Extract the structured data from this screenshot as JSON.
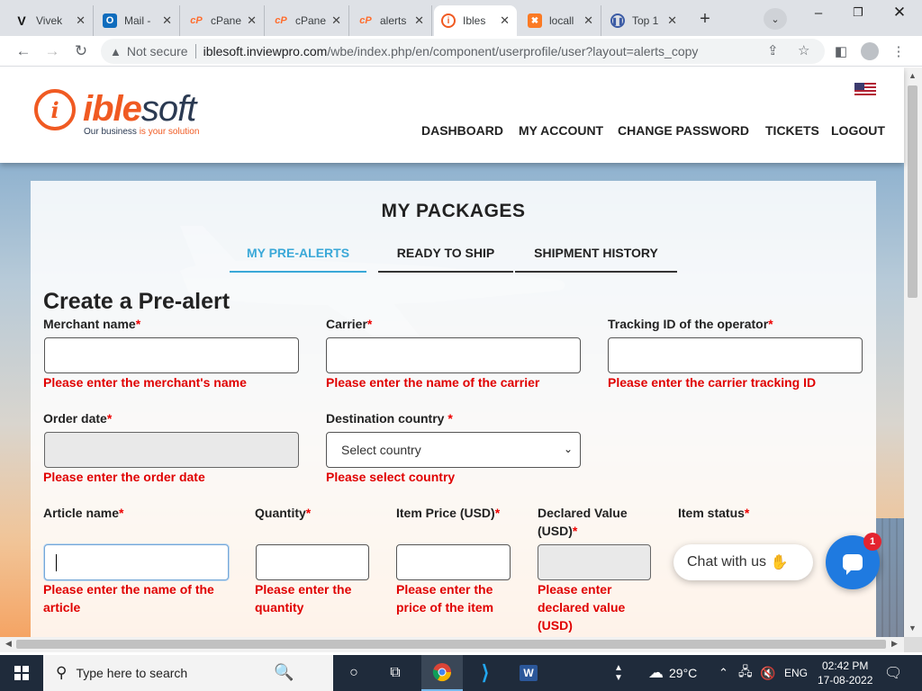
{
  "browser": {
    "tabs": [
      {
        "label": "Vivek",
        "icon": "vivaldi-icon",
        "active": false
      },
      {
        "label": "Mail -",
        "icon": "outlook-icon",
        "active": false
      },
      {
        "label": "cPane",
        "icon": "cpanel-icon",
        "active": false
      },
      {
        "label": "cPane",
        "icon": "cpanel-icon",
        "active": false
      },
      {
        "label": "alerts",
        "icon": "cpanel-icon",
        "active": false
      },
      {
        "label": "Ibles",
        "icon": "iblesoft-icon",
        "active": true
      },
      {
        "label": "locall",
        "icon": "xampp-icon",
        "active": false
      },
      {
        "label": "Top 1",
        "icon": "pause-circle-icon",
        "active": false
      }
    ],
    "new_tab": "+",
    "security_label": "Not secure",
    "url_host": "iblesoft.inviewpro.com",
    "url_path": "/wbe/index.php/en/component/userprofile/user?layout=alerts_copy"
  },
  "site": {
    "logo_part1": "ible",
    "logo_part2": "soft",
    "logo_mark": "i",
    "tagline_part1": "Our business ",
    "tagline_part2": "is your solution",
    "nav": [
      "DASHBOARD",
      "MY ACCOUNT",
      "CHANGE PASSWORD",
      "TICKETS",
      "LOGOUT"
    ]
  },
  "page": {
    "title": "MY PACKAGES",
    "tabs": [
      "MY PRE-ALERTS",
      "READY TO SHIP",
      "SHIPMENT HISTORY"
    ],
    "form_title": "Create a Pre-alert",
    "required_mark": "*",
    "fields": {
      "merchant": {
        "label": "Merchant name",
        "error": "Please enter the merchant's name",
        "value": ""
      },
      "carrier": {
        "label": "Carrier",
        "error": "Please enter the name of the carrier",
        "value": ""
      },
      "tracking": {
        "label": "Tracking ID of the operator",
        "error": "Please enter the carrier tracking ID",
        "value": ""
      },
      "order_date": {
        "label": "Order date",
        "error": "Please enter the order date",
        "value": ""
      },
      "country": {
        "label": "Destination country",
        "error": "Please select country",
        "selected": "Select country"
      },
      "article": {
        "label": "Article name",
        "error_line1": "Please enter the name of the",
        "error_line2": "article",
        "value": ""
      },
      "quantity": {
        "label": "Quantity",
        "error_line1": "Please enter the",
        "error_line2": "quantity",
        "value": ""
      },
      "price": {
        "label": "Item Price (USD)",
        "error_line1": "Please enter the",
        "error_line2": "price of the item",
        "value": ""
      },
      "declared": {
        "label_line1": "Declared Value",
        "label_line2": "(USD)",
        "error_line1": "Please enter",
        "error_line2": "declared value",
        "error_line3": "(USD)",
        "value": ""
      },
      "status": {
        "label": "Item status"
      }
    },
    "chat_label": "Chat with us",
    "chat_badge": "1"
  },
  "taskbar": {
    "search_placeholder": "Type here to search",
    "weather": "29°C",
    "language": "ENG",
    "time": "02:42 PM",
    "date": "17-08-2022"
  },
  "colors": {
    "brand_orange": "#f05a22",
    "brand_navy": "#2b3a52",
    "error_red": "#e00000",
    "tab_active_blue": "#3aa8d8",
    "chat_blue": "#1f7ae0"
  }
}
